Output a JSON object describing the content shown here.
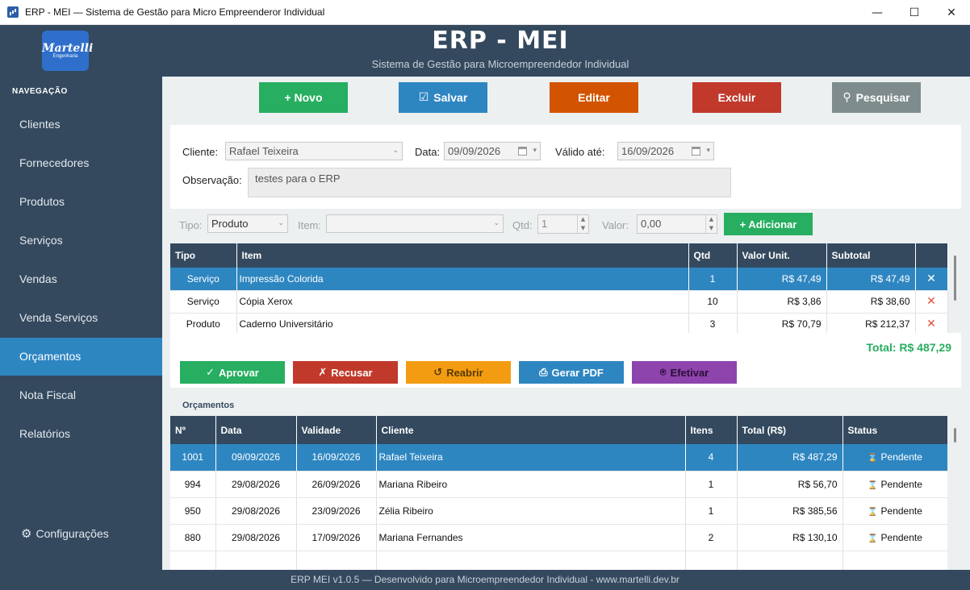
{
  "window": {
    "title": "ERP - MEI — Sistema de Gestão para Micro Empreenderor Individual",
    "minimize": "—",
    "maximize": "☐",
    "close": "✕"
  },
  "header": {
    "logo_text": "Martelli",
    "logo_sub": "Engenharia",
    "title": "ERP - MEI",
    "subtitle": "Sistema de Gestão para Microempreendedor Individual"
  },
  "sidebar": {
    "section_title": "NAVEGAÇÃO",
    "items": [
      {
        "label": "Clientes"
      },
      {
        "label": "Fornecedores"
      },
      {
        "label": "Produtos"
      },
      {
        "label": "Serviços"
      },
      {
        "label": "Vendas"
      },
      {
        "label": "Venda Serviços"
      },
      {
        "label": "Orçamentos",
        "active": true
      },
      {
        "label": "Nota Fiscal"
      },
      {
        "label": "Relatórios"
      }
    ],
    "config_label": "Configurações"
  },
  "toolbar": {
    "novo": "+ Novo",
    "salvar": "Salvar",
    "editar": "Editar",
    "excluir": "Excluir",
    "pesquisar": "Pesquisar"
  },
  "form": {
    "cliente_label": "Cliente:",
    "cliente_value": "Rafael Teixeira",
    "data_label": "Data:",
    "data_value": "09/09/2026",
    "valido_label": "Válido até:",
    "valido_value": "16/09/2026",
    "obs_label": "Observação:",
    "obs_value": "testes para o ERP"
  },
  "item_entry": {
    "tipo_label": "Tipo:",
    "tipo_value": "Produto",
    "item_label": "Item:",
    "item_value": "",
    "qtd_label": "Qtd:",
    "qtd_value": "1",
    "valor_label": "Valor:",
    "valor_value": "0,00",
    "add_label": "+ Adicionar"
  },
  "items_table": {
    "headers": [
      "Tipo",
      "Item",
      "Qtd",
      "Valor Unit.",
      "Subtotal",
      ""
    ],
    "rows": [
      {
        "tipo": "Serviço",
        "item": "Impressão Colorida",
        "qtd": "1",
        "valor": "R$ 47,49",
        "subtotal": "R$ 47,49",
        "remove": "✕"
      },
      {
        "tipo": "Serviço",
        "item": "Cópia Xerox",
        "qtd": "10",
        "valor": "R$ 3,86",
        "subtotal": "R$ 38,60",
        "remove": "✕"
      },
      {
        "tipo": "Produto",
        "item": "Caderno Universitário",
        "qtd": "3",
        "valor": "R$ 70,79",
        "subtotal": "R$ 212,37",
        "remove": "✕"
      }
    ]
  },
  "total_label": "Total: R$ 487,29",
  "actions": {
    "aprovar": "Aprovar",
    "recusar": "Recusar",
    "reabrir": "Reabrir",
    "gerar_pdf": "Gerar PDF",
    "efetivar": "Efetivar"
  },
  "colors": {
    "aprovar": "#27ae60",
    "recusar": "#c0392b",
    "reabrir": "#f39c12",
    "gerar_pdf": "#2e86c1",
    "efetivar": "#8e44ad"
  },
  "orcamentos": {
    "section_label": "Orçamentos",
    "headers": [
      "Nº",
      "Data",
      "Validade",
      "Cliente",
      "Itens",
      "Total (R$)",
      "Status"
    ],
    "rows": [
      {
        "num": "1001",
        "data": "09/09/2026",
        "validade": "16/09/2026",
        "cliente": "Rafael Teixeira",
        "itens": "4",
        "total": "R$ 487,29",
        "status": "Pendente"
      },
      {
        "num": "994",
        "data": "29/08/2026",
        "validade": "26/09/2026",
        "cliente": "Mariana Ribeiro",
        "itens": "1",
        "total": "R$ 56,70",
        "status": "Pendente"
      },
      {
        "num": "950",
        "data": "29/08/2026",
        "validade": "23/09/2026",
        "cliente": "Zélia Ribeiro",
        "itens": "1",
        "total": "R$ 385,56",
        "status": "Pendente"
      },
      {
        "num": "880",
        "data": "29/08/2026",
        "validade": "17/09/2026",
        "cliente": "Mariana Fernandes",
        "itens": "2",
        "total": "R$ 130,10",
        "status": "Pendente"
      }
    ]
  },
  "footer": "ERP MEI v1.0.5  —  Desenvolvido para Microempreendedor Individual  -  www.martelli.dev.br"
}
